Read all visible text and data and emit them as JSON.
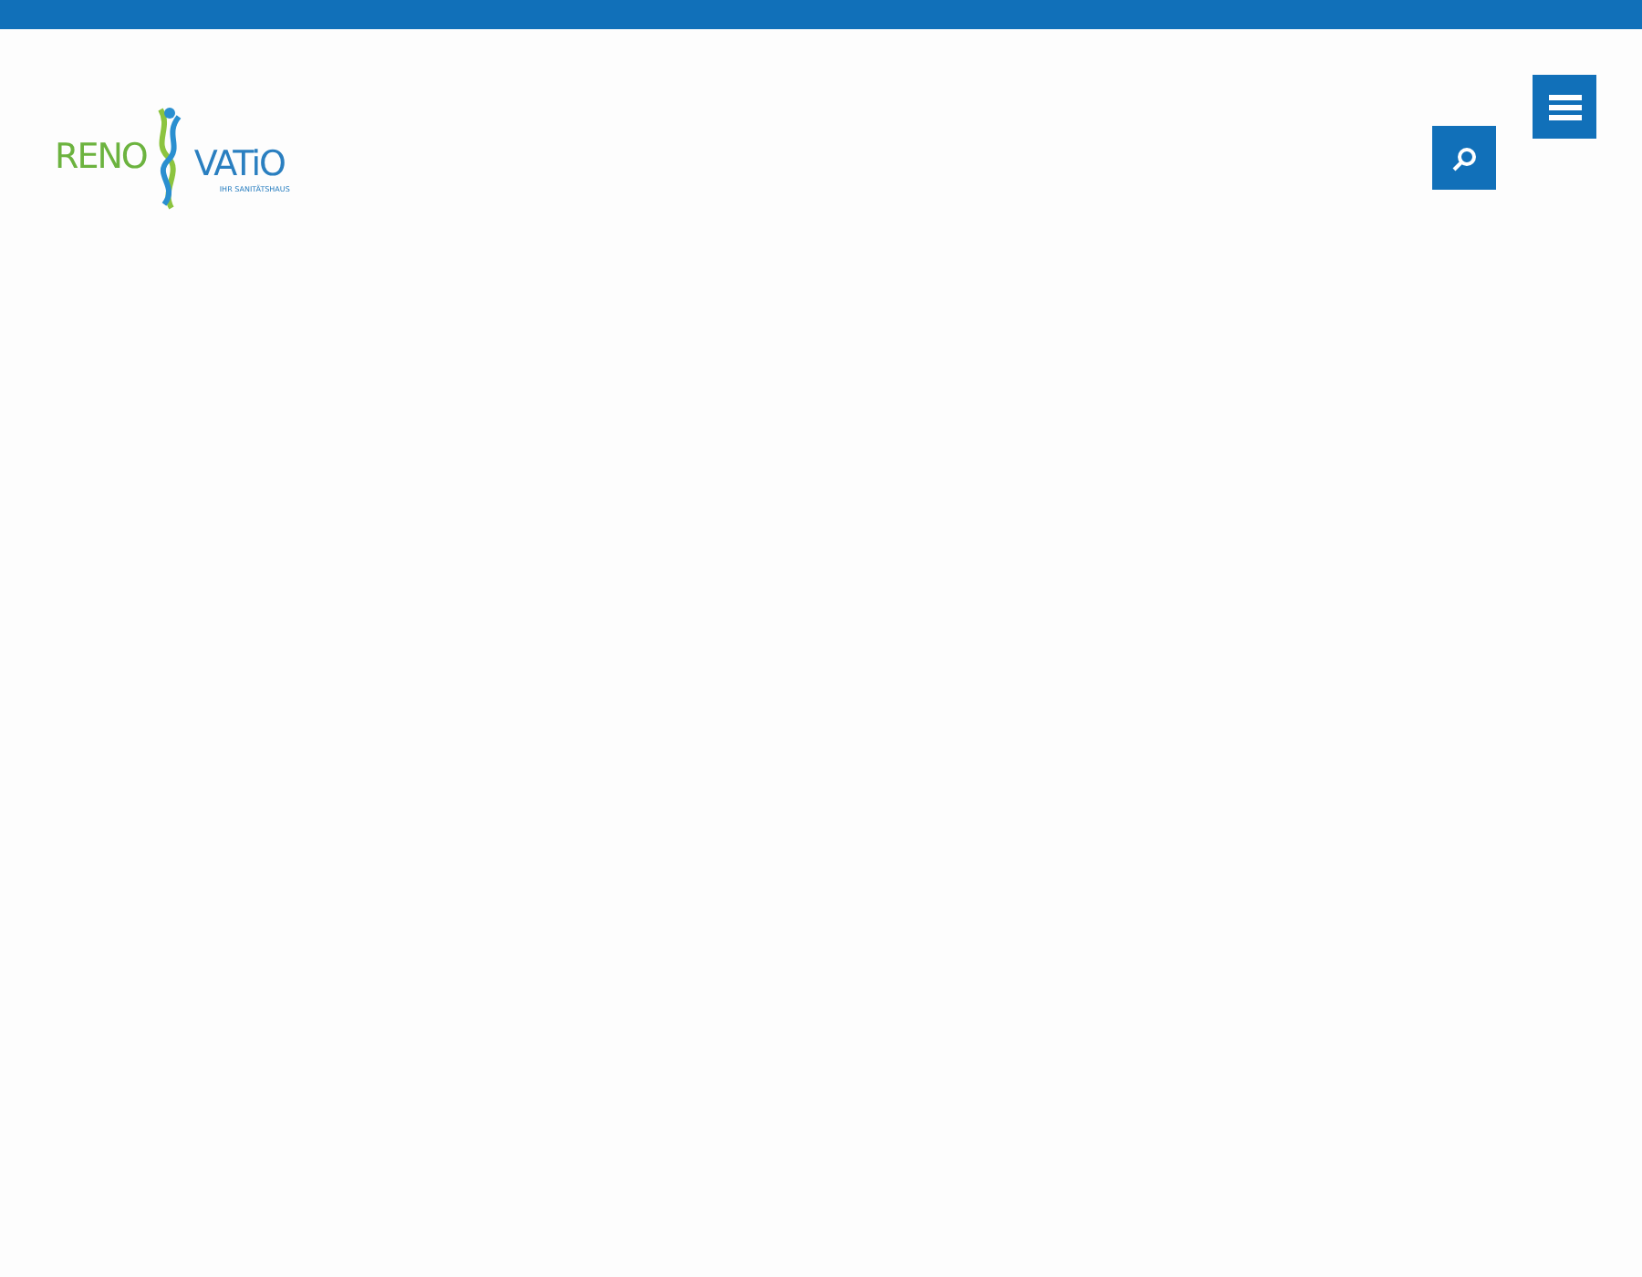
{
  "logo": {
    "left": "RENO",
    "right": "VATiO",
    "tagline": "IHR SANITÄTSHAUS"
  }
}
